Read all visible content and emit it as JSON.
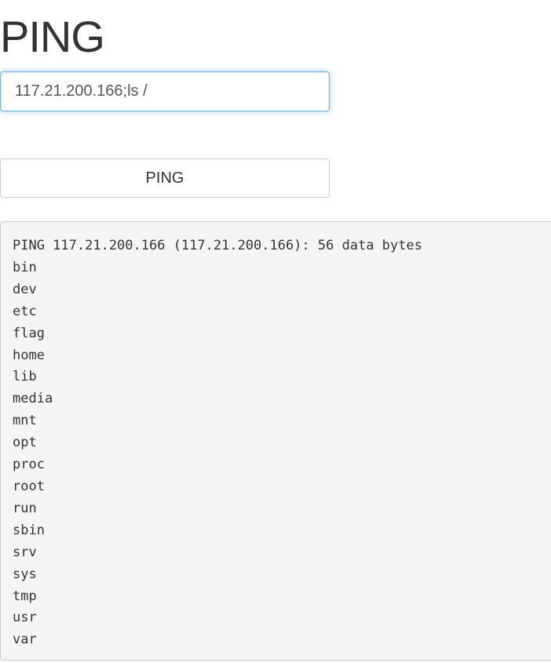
{
  "page": {
    "title": "PING"
  },
  "form": {
    "input_value": "117.21.200.166;ls /",
    "button_label": "PING"
  },
  "output": {
    "lines": [
      "PING 117.21.200.166 (117.21.200.166): 56 data bytes",
      "bin",
      "dev",
      "etc",
      "flag",
      "home",
      "lib",
      "media",
      "mnt",
      "opt",
      "proc",
      "root",
      "run",
      "sbin",
      "srv",
      "sys",
      "tmp",
      "usr",
      "var"
    ]
  },
  "colors": {
    "focus_border": "#66afe9",
    "output_background": "#f5f5f5",
    "text": "#333333"
  }
}
